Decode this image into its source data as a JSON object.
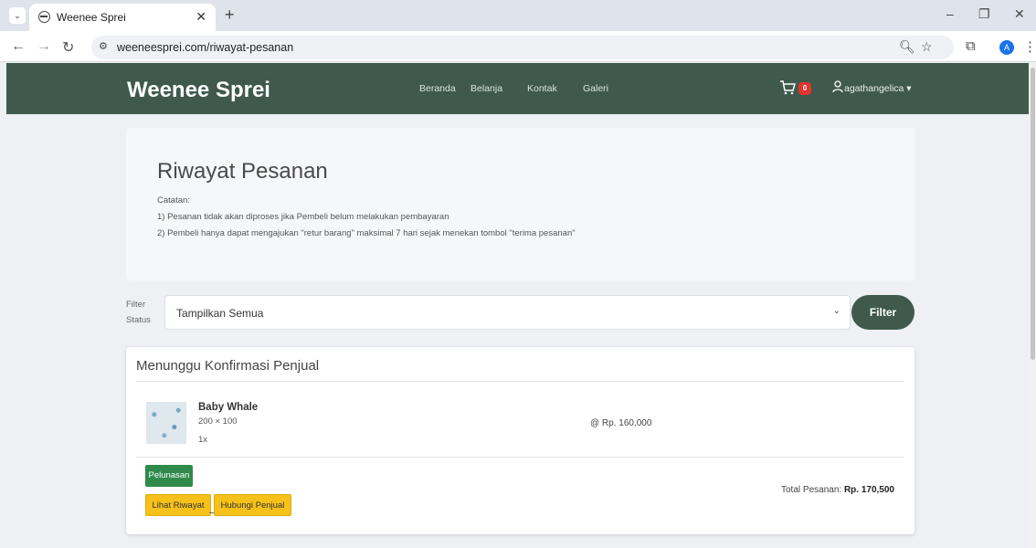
{
  "browser": {
    "tab_title": "Weenee Sprei",
    "url": "weeneesprei.com/riwayat-pesanan",
    "profile_initial": "A"
  },
  "site": {
    "brand": "Weenee Sprei",
    "nav": [
      "Beranda",
      "Belanja",
      "Kontak",
      "Galeri"
    ],
    "cart_count": "0",
    "username": "agathangelica"
  },
  "page": {
    "title": "Riwayat Pesanan",
    "notes_heading": "Catatan:",
    "notes": [
      "1) Pesanan tidak akan diproses jika Pembeli belum melakukan pembayaran",
      "2) Pembeli hanya dapat mengajukan \"retur barang\" maksimal 7 hari sejak menekan tombol \"terima pesanan\""
    ]
  },
  "filter": {
    "label_line1": "Filter",
    "label_line2": "Status",
    "selected": "Tampilkan Semua",
    "button": "Filter"
  },
  "order": {
    "status": "Menunggu Konfirmasi Penjual",
    "product_name": "Baby Whale",
    "product_size": "200 × 100",
    "product_qty": "1x",
    "unit_price": "@ Rp. 160,000",
    "btn_pay": "Pelunasan",
    "btn_history": "Lihat Riwayat",
    "btn_contact": "Hubungi Penjual",
    "total_label": "Total Pesanan:",
    "total_value": "Rp. 170,500"
  },
  "colors": {
    "navbar": "#3f5a4d",
    "btn_pay": "#2f8a4b",
    "btn_yellow": "#f5c11a",
    "badge": "#e0342d"
  }
}
